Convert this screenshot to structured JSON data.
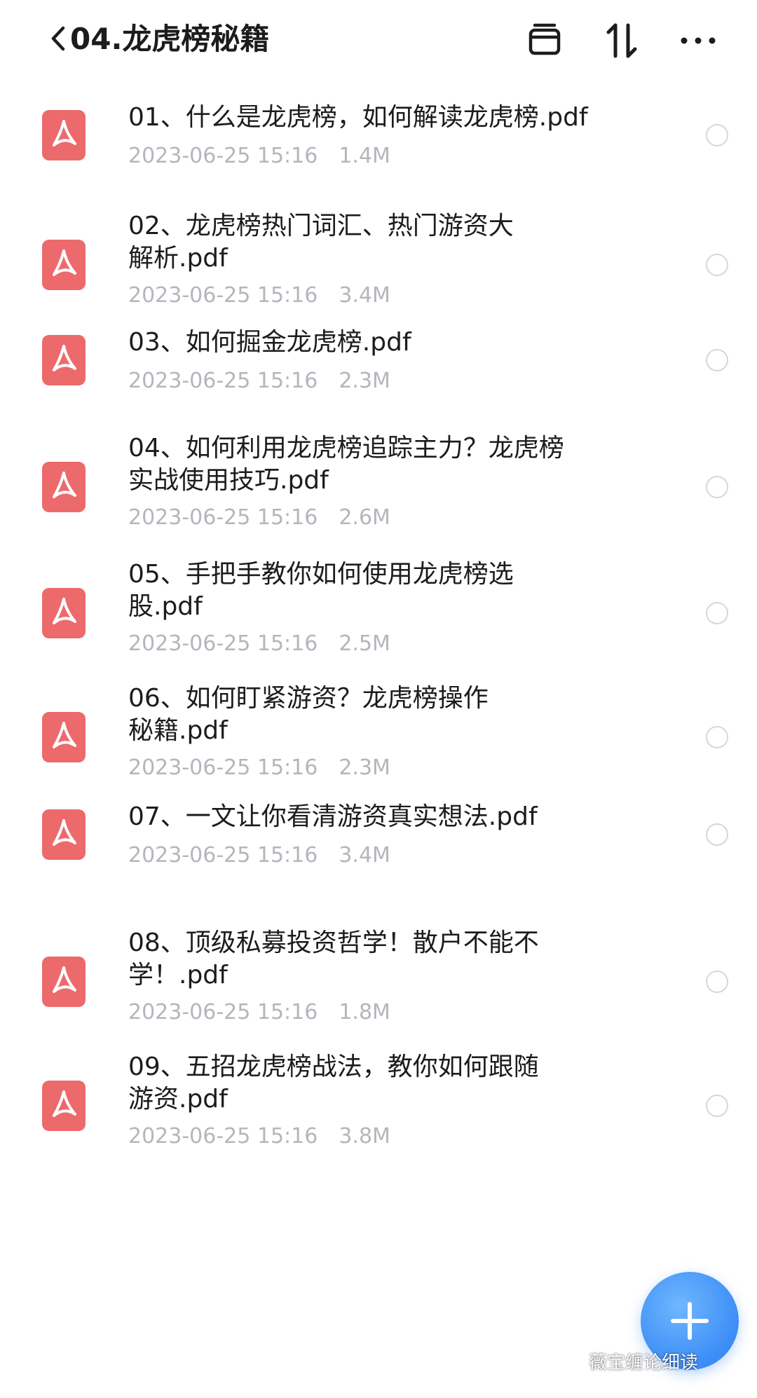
{
  "header": {
    "title": "04.龙虎榜秘籍",
    "actions": [
      "archive-icon",
      "sort-icon",
      "more-icon"
    ]
  },
  "files": [
    {
      "line1": "01、什么是龙虎榜，如何解读龙虎榜.pdf",
      "line2": "",
      "date": "2023-06-25 15:16",
      "size": "1.4M"
    },
    {
      "line1": "02、龙虎榜热门词汇、热门游资大",
      "line2": "解析.pdf",
      "date": "2023-06-25 15:16",
      "size": "3.4M"
    },
    {
      "line1": "03、如何掘金龙虎榜.pdf",
      "line2": "",
      "date": "2023-06-25 15:16",
      "size": "2.3M"
    },
    {
      "line1": "04、如何利用龙虎榜追踪主力？龙虎榜",
      "line2": "实战使用技巧.pdf",
      "date": "2023-06-25 15:16",
      "size": "2.6M"
    },
    {
      "line1": "05、手把手教你如何使用龙虎榜选",
      "line2": "股.pdf",
      "date": "2023-06-25 15:16",
      "size": "2.5M"
    },
    {
      "line1": "06、如何盯紧游资？龙虎榜操作",
      "line2": "秘籍.pdf",
      "date": "2023-06-25 15:16",
      "size": "2.3M"
    },
    {
      "line1": "07、一文让你看清游资真实想法.pdf",
      "line2": "",
      "date": "2023-06-25 15:16",
      "size": "3.4M"
    },
    {
      "line1": "08、顶级私募投资哲学！散户不能不",
      "line2": "学！.pdf",
      "date": "2023-06-25 15:16",
      "size": "1.8M"
    },
    {
      "line1": "09、五招龙虎榜战法，教你如何跟随",
      "line2": "游资.pdf",
      "date": "2023-06-25 15:16",
      "size": "3.8M"
    }
  ],
  "fab": {
    "icon": "plus-icon"
  },
  "watermark": {
    "text": "薇宝缠论细读"
  },
  "colors": {
    "pdf": "#ec6a6c",
    "meta": "#b4b6bd",
    "fab": "#3c8df6"
  }
}
